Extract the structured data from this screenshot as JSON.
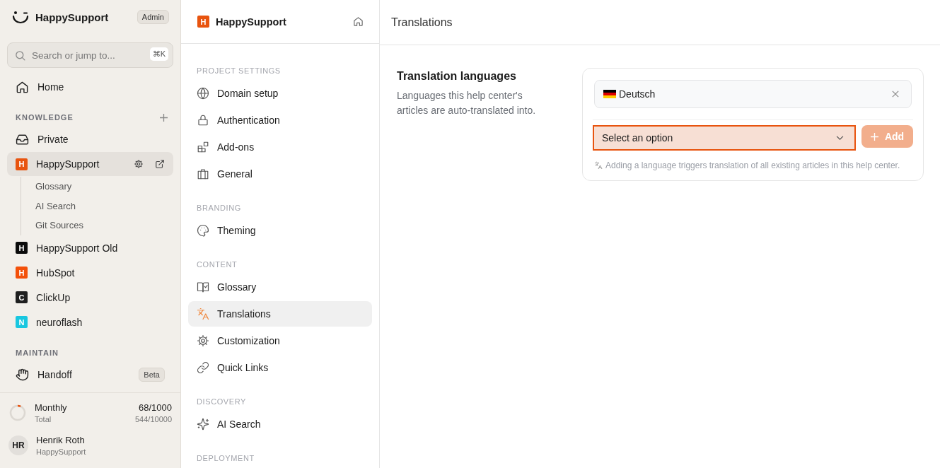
{
  "sidebar": {
    "brand": "HappySupport",
    "role_badge": "Admin",
    "search": {
      "placeholder": "Search or jump to...",
      "shortcut": "⌘K"
    },
    "home": {
      "kind": "home",
      "label": "Home",
      "selected": false
    },
    "sections": [
      {
        "title": "KNOWLEDGE",
        "add_button": true,
        "items": [
          {
            "kind": "inbox",
            "label": "Private",
            "selected": false
          },
          {
            "kind": "project",
            "letter": "H",
            "color": "#e8540f",
            "label": "HappySupport",
            "selected": true,
            "children": [
              {
                "label": "Glossary"
              },
              {
                "label": "AI Search"
              },
              {
                "label": "Git Sources"
              }
            ]
          },
          {
            "kind": "project",
            "letter": "H",
            "color": "#0b0b0b",
            "label": "HappySupport Old",
            "selected": false
          },
          {
            "kind": "project",
            "letter": "H",
            "color": "#f3500a",
            "label": "HubSpot",
            "selected": false
          },
          {
            "kind": "project",
            "letter": "C",
            "color": "#1f1f1f",
            "label": "ClickUp",
            "selected": false
          },
          {
            "kind": "project",
            "letter": "N",
            "color": "#19c7e0",
            "label": "neuroflash",
            "selected": false
          }
        ]
      },
      {
        "title": "MAINTAIN",
        "add_button": false,
        "items": [
          {
            "kind": "hand",
            "label": "Handoff",
            "selected": false,
            "badge": "Beta"
          }
        ]
      }
    ],
    "usage": {
      "label": "Monthly",
      "value": "68/1000",
      "sublabel": "Total",
      "subvalue": "544/10000",
      "level": 0.068
    },
    "user": {
      "initials": "HR",
      "name": "Henrik Roth",
      "org": "HappySupport"
    }
  },
  "settings_nav": {
    "project": {
      "letter": "H",
      "name": "HappySupport"
    },
    "sections": [
      {
        "title": "PROJECT SETTINGS",
        "items": [
          {
            "kind": "globe",
            "label": "Domain setup",
            "selected": false
          },
          {
            "kind": "lock",
            "label": "Authentication",
            "selected": false
          },
          {
            "kind": "addons",
            "label": "Add-ons",
            "selected": false
          },
          {
            "kind": "briefcase",
            "label": "General",
            "selected": false
          }
        ]
      },
      {
        "title": "BRANDING",
        "items": [
          {
            "kind": "palette",
            "label": "Theming",
            "selected": false
          }
        ]
      },
      {
        "title": "CONTENT",
        "items": [
          {
            "kind": "book",
            "label": "Glossary",
            "selected": false
          },
          {
            "kind": "translate",
            "label": "Translations",
            "selected": true
          },
          {
            "kind": "gear",
            "label": "Customization",
            "selected": false
          },
          {
            "kind": "link",
            "label": "Quick Links",
            "selected": false
          }
        ]
      },
      {
        "title": "DISCOVERY",
        "items": [
          {
            "kind": "sparkle",
            "label": "AI Search",
            "selected": false
          }
        ]
      },
      {
        "title": "DEPLOYMENT"
      }
    ]
  },
  "page": {
    "title": "Translations",
    "section": {
      "title": "Translation languages",
      "description": "Languages this help center's articles are auto-translated into.",
      "languages": [
        {
          "name": "Deutsch"
        }
      ],
      "select": {
        "placeholder": "Select an option",
        "focused": true
      },
      "add_button": {
        "label": "Add",
        "disabled": true
      },
      "hint": "Adding a language triggers translation of all existing articles in this help center."
    }
  }
}
